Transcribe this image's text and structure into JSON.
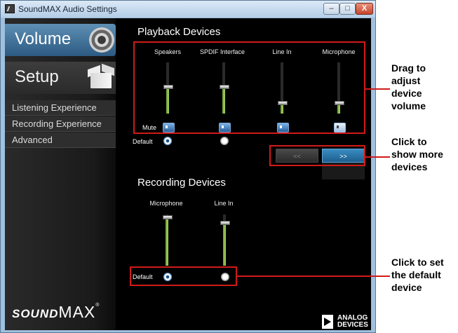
{
  "window": {
    "title": "SoundMAX Audio Settings",
    "controls": {
      "minimize": "–",
      "maximize": "□",
      "close": "X"
    }
  },
  "sidebar": {
    "tabs": [
      {
        "label": "Volume",
        "icon": "speaker-icon",
        "active": true
      },
      {
        "label": "Setup",
        "icon": "box-icon",
        "active": false
      }
    ],
    "items": [
      {
        "label": "Listening Experience"
      },
      {
        "label": "Recording Experience"
      },
      {
        "label": "Advanced"
      }
    ],
    "logo": {
      "part1": "SOUND",
      "part2": "MAX",
      "mark": "®"
    }
  },
  "playback": {
    "title": "Playback Devices",
    "mute_label": "Mute",
    "default_label": "Default",
    "devices": [
      {
        "name": "Speakers",
        "level": 0.52,
        "muted": false,
        "default": true
      },
      {
        "name": "SPDIF Interface",
        "level": 0.52,
        "muted": false,
        "default": false
      },
      {
        "name": "Line In",
        "level": 0.2,
        "muted": false,
        "default": false
      },
      {
        "name": "Microphone",
        "level": 0.2,
        "muted": true,
        "default": false
      }
    ],
    "nav": {
      "prev": "<<",
      "next": ">>"
    }
  },
  "recording": {
    "title": "Recording Devices",
    "default_label": "Default",
    "devices": [
      {
        "name": "Microphone",
        "level": 0.95,
        "default": true
      },
      {
        "name": "Line In",
        "level": 0.83,
        "default": false
      }
    ]
  },
  "brand": {
    "line1": "ANALOG",
    "line2": "DEVICES"
  },
  "callouts": {
    "drag": "Drag to\nadjust\ndevice\nvolume",
    "more": "Click to\nshow more\ndevices",
    "default": "Click to set\nthe default\ndevice"
  },
  "colors": {
    "callout": "#d11a1a",
    "accent": "#2c6fa3",
    "level": "#8dc04a"
  }
}
